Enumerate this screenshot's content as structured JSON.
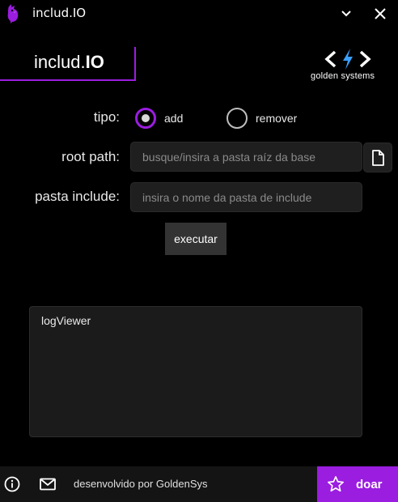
{
  "window": {
    "title": "includ.IO",
    "app_icon": "bird-icon",
    "controls": [
      "chevron-down-icon",
      "close-icon"
    ]
  },
  "brand": {
    "name_plain": "includ.",
    "name_bold": "IO",
    "company_logo": "code-bolt-icon",
    "company": "golden systems"
  },
  "form": {
    "tipo_label": "tipo:",
    "radio_add": "add",
    "radio_remove": "remover",
    "selected": "add",
    "root_label": "root path:",
    "root_placeholder": "busque/insira a pasta raíz da base",
    "root_value": "",
    "include_label": "pasta include:",
    "include_placeholder": "insira o nome da pasta de include",
    "include_value": "",
    "file_button_icon": "file-icon",
    "execute": "executar"
  },
  "log": {
    "text": "logViewer"
  },
  "footer": {
    "info_icon": "info-icon",
    "mail_icon": "mail-icon",
    "credit": "desenvolvido por GoldenSys",
    "donate_icon": "star-icon",
    "donate": "doar"
  },
  "colors": {
    "accent": "#9b1de0",
    "background": "#000000",
    "input_bg": "#1f1f1f",
    "bolt": "#3aa0ff"
  }
}
